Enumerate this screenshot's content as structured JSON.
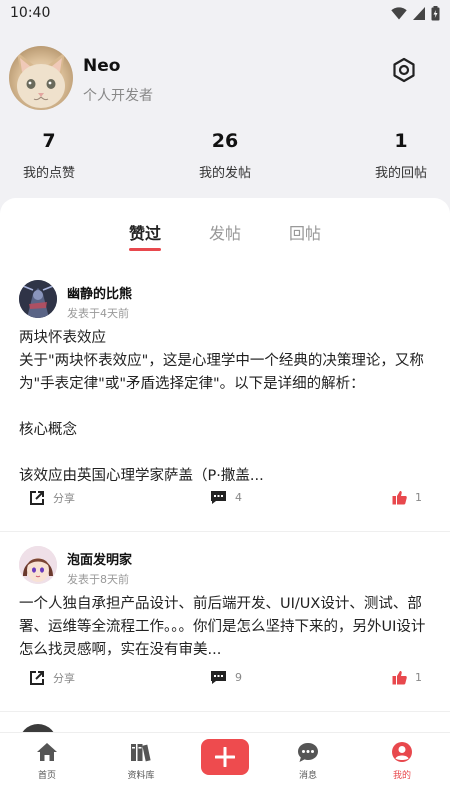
{
  "status_bar": {
    "time": "10:40"
  },
  "profile": {
    "name": "Neo",
    "bio": "个人开发者"
  },
  "stats": [
    {
      "value": "7",
      "label": "我的点赞"
    },
    {
      "value": "26",
      "label": "我的发帖"
    },
    {
      "value": "1",
      "label": "我的回帖"
    }
  ],
  "tabs": [
    {
      "label": "赞过",
      "active": true
    },
    {
      "label": "发帖",
      "active": false
    },
    {
      "label": "回帖",
      "active": false
    }
  ],
  "posts": [
    {
      "author": "幽静的比熊",
      "time": "发表于4天前",
      "body": "两块怀表效应\n关于\"两块怀表效应\"，这是心理学中一个经典的决策理论，又称为\"手表定律\"或\"矛盾选择定律\"。以下是详细的解析：\n\n核心概念\n\n该效应由英国心理学家萨盖（P·撒盖...",
      "share_label": "分享",
      "comments": "4",
      "likes": "1"
    },
    {
      "author": "泡面发明家",
      "time": "发表于8天前",
      "body": "一个人独自承担产品设计、前后端开发、UI/UX设计、测试、部署、运维等全流程工作。。。你们是怎么坚持下来的，另外UI设计怎么找灵感啊，实在没有审美...",
      "share_label": "分享",
      "comments": "9",
      "likes": "1"
    }
  ],
  "bottom_nav": [
    {
      "label": "首页",
      "icon": "home-icon"
    },
    {
      "label": "资料库",
      "icon": "library-icon"
    },
    {
      "label": "",
      "icon": "plus-icon"
    },
    {
      "label": "消息",
      "icon": "message-icon"
    },
    {
      "label": "我的",
      "icon": "profile-icon",
      "active": true
    }
  ],
  "colors": {
    "accent": "#e8484d",
    "background": "#f1f1f4",
    "card": "#ffffff"
  }
}
